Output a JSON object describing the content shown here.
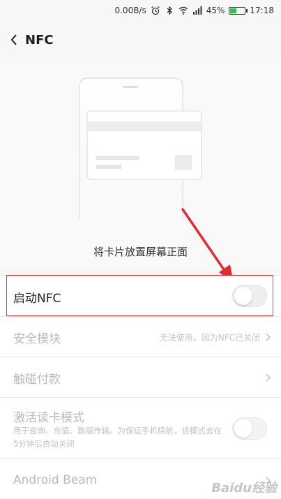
{
  "status_bar": {
    "speed": "0.00B/s",
    "battery_percent_text": "45%",
    "battery_level": 0.45,
    "time": "17:18",
    "icons": [
      "alarm-icon",
      "bluetooth-icon",
      "wifi-icon",
      "signal-icon",
      "battery-icon"
    ]
  },
  "header": {
    "title": "NFC"
  },
  "hero": {
    "caption": "将卡片放置屏幕正面"
  },
  "rows": {
    "enable_nfc": {
      "label": "启动NFC",
      "toggle_on": false
    },
    "security_module": {
      "label": "安全模块",
      "value": "无法使用，因为NFC已关闭"
    },
    "tap_pay": {
      "label": "触碰付款"
    },
    "reader_mode": {
      "label": "激活读卡模式",
      "description": "用于查询、充值、数据传输。为保证手机续航，该模式会在5分钟后自动关闭",
      "toggle_on": false
    },
    "android_beam": {
      "label": "Android Beam"
    }
  },
  "watermark": "Baidu经验",
  "colors": {
    "highlight_border": "#d9363e",
    "arrow": "#e02a34",
    "battery": "#30c24a"
  }
}
